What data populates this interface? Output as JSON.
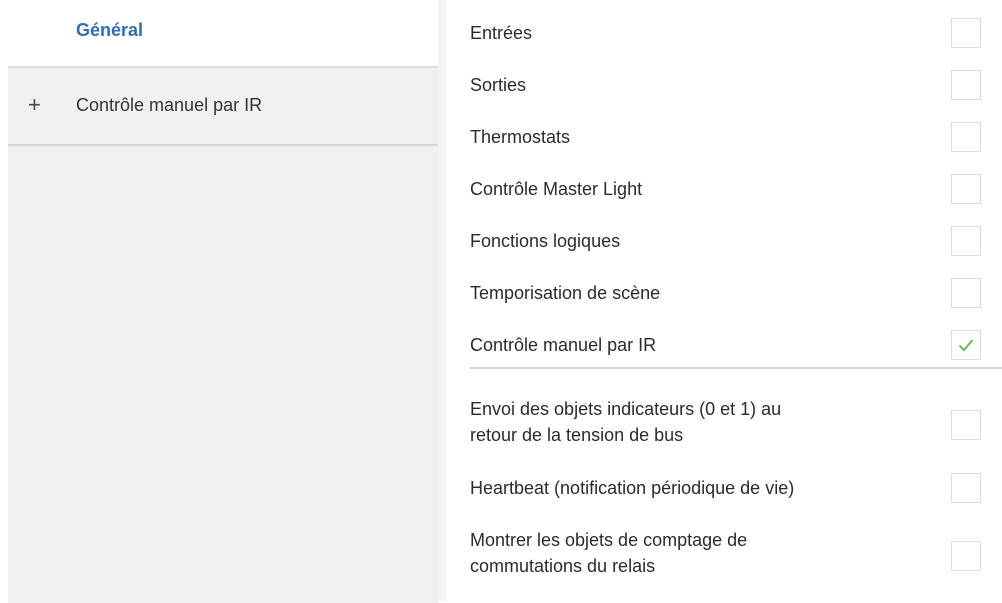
{
  "sidebar": {
    "header": "Général",
    "items": [
      {
        "expand_icon": "+",
        "label": "Contrôle manuel par IR"
      }
    ]
  },
  "main": {
    "options": [
      {
        "label": "Entrées",
        "checked": false
      },
      {
        "label": "Sorties",
        "checked": false
      },
      {
        "label": "Thermostats",
        "checked": false
      },
      {
        "label": "Contrôle Master Light",
        "checked": false
      },
      {
        "label": "Fonctions logiques",
        "checked": false
      },
      {
        "label": "Temporisation de scène",
        "checked": false
      },
      {
        "label": "Contrôle manuel par IR",
        "checked": true
      }
    ],
    "extra_options": [
      {
        "label_line1": "Envoi des objets indicateurs (0 et 1) au",
        "label_line2": "retour de la tension de bus",
        "checked": false
      },
      {
        "label": "Heartbeat (notification périodique de vie)",
        "checked": false
      },
      {
        "label_line1": "Montrer les objets de comptage de",
        "label_line2": "commutations du relais",
        "checked": false
      }
    ]
  },
  "colors": {
    "accent": "#2f6db5",
    "check": "#6aba5c",
    "border": "#dcdcdc"
  }
}
